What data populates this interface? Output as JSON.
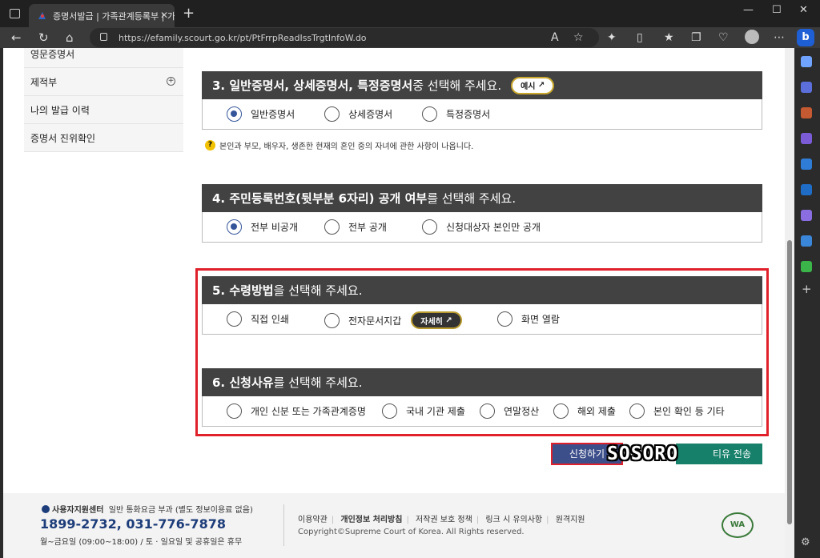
{
  "browser": {
    "tab_title": "증명서발급 | 가족관계등록부 | 가",
    "url": "https://efamily.scourt.go.kr/pt/PtFrrpReadIssTrgtInfoW.do"
  },
  "left_menu": [
    {
      "label": "영문증명서"
    },
    {
      "label": "제적부"
    },
    {
      "label": "나의 발급 이력"
    },
    {
      "label": "증명서 진위확인"
    }
  ],
  "section3": {
    "title_bold": "3. 일반증명서, 상세증명서, 특정증명서",
    "title_rest": " 중 선택해 주세요.",
    "example_label": "예시",
    "options": [
      "일반증명서",
      "상세증명서",
      "특정증명서"
    ],
    "selected": "일반증명서",
    "note": "본인과 부모, 배우자, 생존한 현재의 혼인 중의 자녀에 관한 사항이 나옵니다."
  },
  "section4": {
    "title_bold": "4. 주민등록번호(뒷부분 6자리) 공개 여부",
    "title_rest": "를 선택해 주세요.",
    "options": [
      "전부 비공개",
      "전부 공개",
      "신청대상자 본인만 공개"
    ],
    "selected": "전부 비공개"
  },
  "section5": {
    "title_bold": "5. 수령방법",
    "title_rest": "을 선택해 주세요.",
    "options": [
      "직접 인쇄",
      "전자문서지갑",
      "화면 열람"
    ],
    "detail_label": "자세히"
  },
  "section6": {
    "title_bold": "6. 신청사유",
    "title_rest": "를 선택해 주세요.",
    "options": [
      "개인 신분 또는 가족관계증명",
      "국내 기관 제출",
      "연말정산",
      "해외 제출",
      "본인 확인 등 기타"
    ]
  },
  "actions": {
    "apply_label": "신청하기",
    "send_label": "티유 전송",
    "watermark": "SOSORO"
  },
  "footer": {
    "center_title": "사용자지원센터",
    "center_note": "일반 통화요금 부과 (별도 정보이용료 없음)",
    "phone": "1899-2732, 031-776-7878",
    "hours": "월~금요일 (09:00~18:00) / 토 · 일요일 및 공휴일은 휴무",
    "links": [
      "이용약관",
      "개인정보 처리방침",
      "저작권 보호 정책",
      "링크 시 유의사항",
      "원격지원"
    ],
    "copyright": "Copyright©Supreme Court of Korea. All Rights reserved.",
    "badge": "WA"
  },
  "colors": {
    "accent": "#35559a",
    "highlight": "#e0202a",
    "header": "#424242"
  }
}
